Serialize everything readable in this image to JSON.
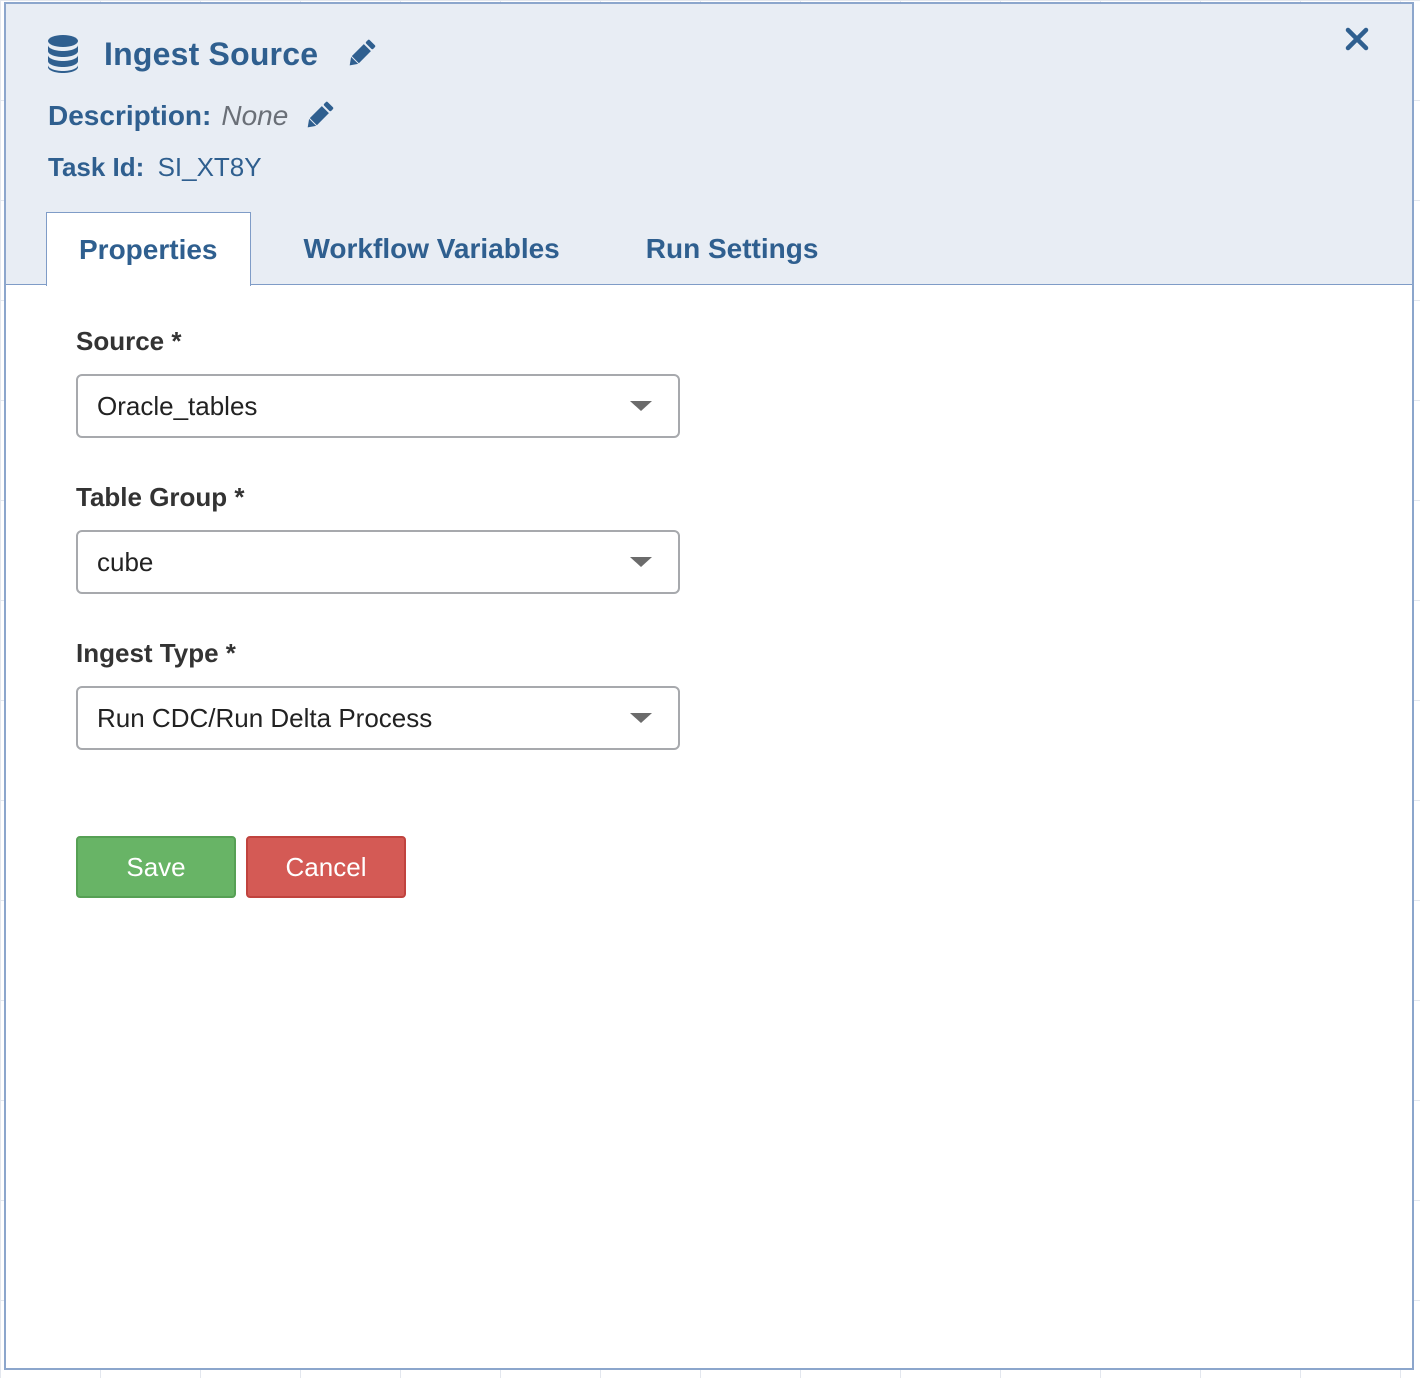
{
  "colors": {
    "header_bg": "#e8edf4",
    "accent": "#2f5f8f",
    "save": "#68b466",
    "cancel": "#d45a55"
  },
  "header": {
    "title": "Ingest Source",
    "title_icon": "database-icon",
    "edit_icon": "pencil-icon",
    "close_icon": "close-icon",
    "description_label": "Description:",
    "description_value": "None",
    "task_id_label": "Task Id:",
    "task_id_value": "SI_XT8Y"
  },
  "tabs": [
    {
      "label": "Properties",
      "active": true
    },
    {
      "label": "Workflow Variables",
      "active": false
    },
    {
      "label": "Run Settings",
      "active": false
    }
  ],
  "form": {
    "source": {
      "label": "Source *",
      "value": "Oracle_tables"
    },
    "table_group": {
      "label": "Table Group *",
      "value": "cube"
    },
    "ingest_type": {
      "label": "Ingest Type *",
      "value": "Run CDC/Run Delta Process"
    }
  },
  "buttons": {
    "save_label": "Save",
    "cancel_label": "Cancel"
  }
}
